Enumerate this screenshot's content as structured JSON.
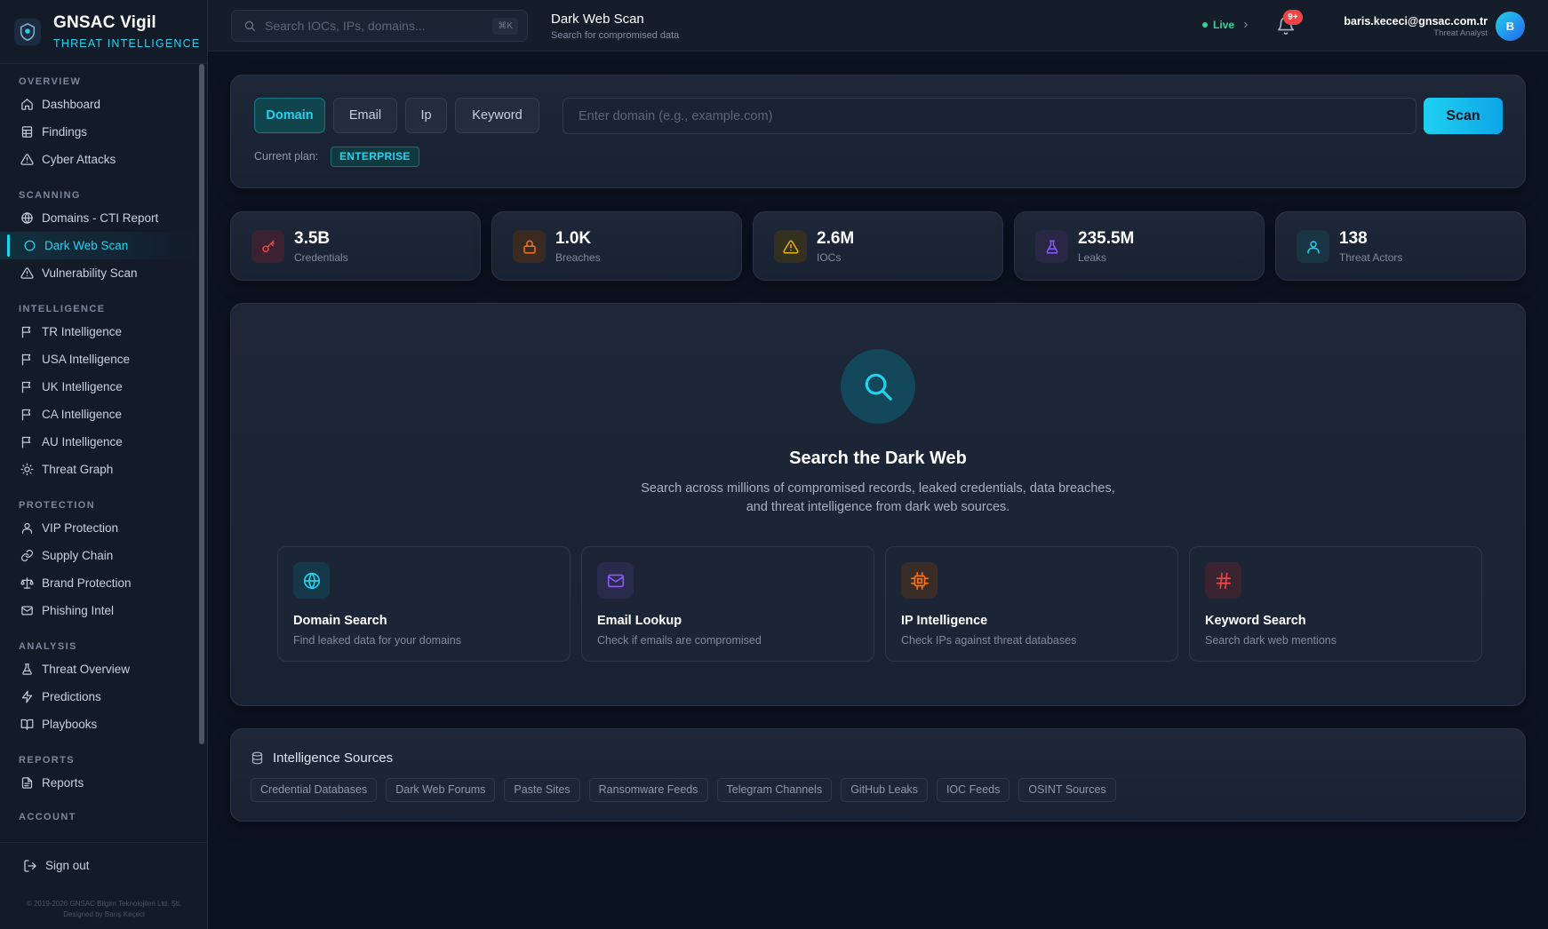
{
  "brand": {
    "name": "GNSAC Vigil",
    "subtitle": "THREAT INTELLIGENCE"
  },
  "sidebar": {
    "sections": [
      {
        "title": "OVERVIEW",
        "items": [
          {
            "label": "Dashboard",
            "icon": "home-icon"
          },
          {
            "label": "Findings",
            "icon": "table-icon"
          },
          {
            "label": "Cyber Attacks",
            "icon": "alert-triangle-icon"
          }
        ]
      },
      {
        "title": "SCANNING",
        "items": [
          {
            "label": "Domains - CTI Report",
            "icon": "globe-icon"
          },
          {
            "label": "Dark Web Scan",
            "icon": "circle-icon",
            "active": true
          },
          {
            "label": "Vulnerability Scan",
            "icon": "alert-triangle-icon"
          }
        ]
      },
      {
        "title": "INTELLIGENCE",
        "items": [
          {
            "label": "TR Intelligence",
            "icon": "flag-icon"
          },
          {
            "label": "USA Intelligence",
            "icon": "flag-icon"
          },
          {
            "label": "UK Intelligence",
            "icon": "flag-icon"
          },
          {
            "label": "CA Intelligence",
            "icon": "flag-icon"
          },
          {
            "label": "AU Intelligence",
            "icon": "flag-icon"
          },
          {
            "label": "Threat Graph",
            "icon": "bulb-icon"
          }
        ]
      },
      {
        "title": "PROTECTION",
        "items": [
          {
            "label": "VIP Protection",
            "icon": "user-icon"
          },
          {
            "label": "Supply Chain",
            "icon": "link-icon"
          },
          {
            "label": "Brand Protection",
            "icon": "scale-icon"
          },
          {
            "label": "Phishing Intel",
            "icon": "mail-icon"
          }
        ]
      },
      {
        "title": "ANALYSIS",
        "items": [
          {
            "label": "Threat Overview",
            "icon": "flask-icon"
          },
          {
            "label": "Predictions",
            "icon": "zap-icon"
          },
          {
            "label": "Playbooks",
            "icon": "book-icon"
          }
        ]
      },
      {
        "title": "REPORTS",
        "items": [
          {
            "label": "Reports",
            "icon": "file-icon"
          }
        ]
      },
      {
        "title": "ACCOUNT",
        "items": []
      }
    ],
    "signout": "Sign out",
    "copyright": "© 2019-2026 GNSAC Bilgim Teknolojileri Ltd. Şti.",
    "designer": "Designed by Barış Keçeci"
  },
  "header": {
    "search_placeholder": "Search IOCs, IPs, domains...",
    "search_shortcut": "⌘K",
    "title": "Dark Web Scan",
    "subtitle": "Search for compromised data",
    "live_label": "Live",
    "notification_count": "9+",
    "user_email": "baris.kececi@gnsac.com.tr",
    "user_role": "Threat Analyst",
    "avatar_initial": "B"
  },
  "scan": {
    "types": [
      "Domain",
      "Email",
      "Ip",
      "Keyword"
    ],
    "active_type": "Domain",
    "input_placeholder": "Enter domain (e.g., example.com)",
    "input_value": "",
    "button": "Scan",
    "plan_label": "Current plan:",
    "plan": "ENTERPRISE"
  },
  "stats": [
    {
      "value": "3.5B",
      "label": "Credentials",
      "icon": "key-icon",
      "color": "#ef4444",
      "bg": "#3a2230"
    },
    {
      "value": "1.0K",
      "label": "Breaches",
      "icon": "lock-icon",
      "color": "#f97316",
      "bg": "#3a2a22"
    },
    {
      "value": "2.6M",
      "label": "IOCs",
      "icon": "alert-triangle-icon",
      "color": "#eab308",
      "bg": "#34301f"
    },
    {
      "value": "235.5M",
      "label": "Leaks",
      "icon": "flask-icon",
      "color": "#8b5cf6",
      "bg": "#2a2645"
    },
    {
      "value": "138",
      "label": "Threat Actors",
      "icon": "user-icon",
      "color": "#22d3ee",
      "bg": "#193443"
    }
  ],
  "hero": {
    "title": "Search the Dark Web",
    "description": "Search across millions of compromised records, leaked credentials, data breaches, and threat intelligence from dark web sources.",
    "features": [
      {
        "title": "Domain Search",
        "desc": "Find leaked data for your domains",
        "icon": "globe-icon",
        "color": "#22d3ee",
        "bg": "#16394a"
      },
      {
        "title": "Email Lookup",
        "desc": "Check if emails are compromised",
        "icon": "mail-icon",
        "color": "#8b5cf6",
        "bg": "#2a2a4c"
      },
      {
        "title": "IP Intelligence",
        "desc": "Check IPs against threat databases",
        "icon": "cpu-icon",
        "color": "#f97316",
        "bg": "#3a2c26"
      },
      {
        "title": "Keyword Search",
        "desc": "Search dark web mentions",
        "icon": "hash-icon",
        "color": "#ef4444",
        "bg": "#3a2430"
      }
    ]
  },
  "sources": {
    "title": "Intelligence Sources",
    "items": [
      "Credential Databases",
      "Dark Web Forums",
      "Paste Sites",
      "Ransomware Feeds",
      "Telegram Channels",
      "GitHub Leaks",
      "IOC Feeds",
      "OSINT Sources"
    ]
  }
}
